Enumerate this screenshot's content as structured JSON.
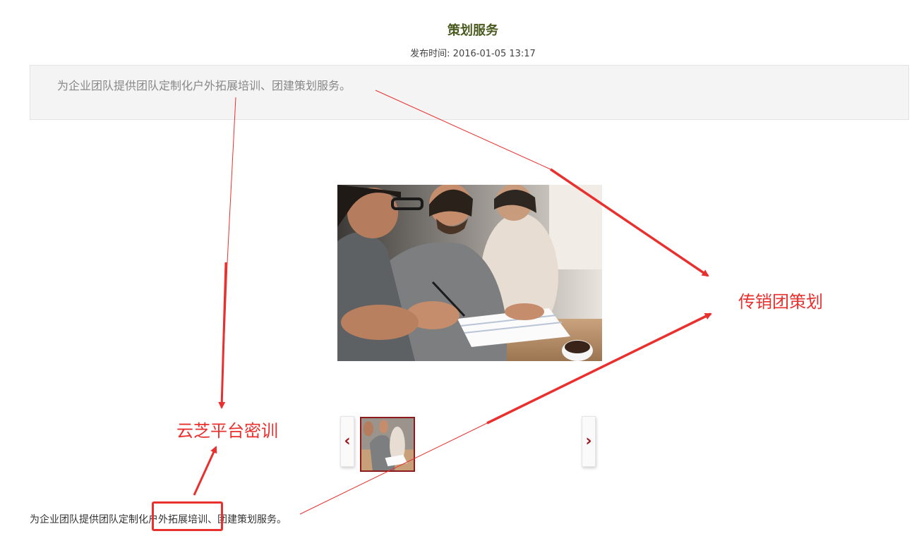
{
  "article": {
    "title": "策划服务",
    "meta_text": "发布时间: 2016-01-05 13:17",
    "summary": "为企业团队提供团队定制化户外拓展培训、团建策划服务。",
    "body": "为企业团队提供团队定制化户外拓展培训、团建策划服务。"
  },
  "gallery": {
    "main_image_description": "photo-meeting-document-signing",
    "prev_icon": "‹",
    "next_icon": "›",
    "prev_icon_name": "chevron-left-icon",
    "next_icon_name": "chevron-right-icon",
    "accent_color": "#a0141b"
  },
  "annotations": {
    "left_label": "云芝平台密训",
    "right_label": "传销团策划",
    "color": "#e8312f"
  }
}
